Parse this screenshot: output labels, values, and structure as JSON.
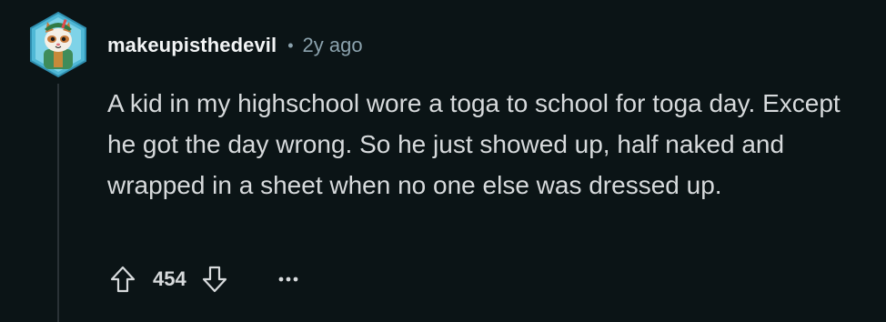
{
  "comment": {
    "username": "makeupisthedevil",
    "separator": "•",
    "timestamp": "2y ago",
    "body": "A kid in my highschool wore a toga to school for toga day. Except he got the day wrong. So he just showed up, half naked and wrapped in a sheet when no one else was dressed up.",
    "score": "454"
  },
  "icons": {
    "avatar": "cat-avatar-icon",
    "upvote": "upvote-arrow-icon",
    "downvote": "downvote-arrow-icon",
    "more": "more-options-icon"
  },
  "colors": {
    "background": "#0b1416",
    "username": "#f2f4f5",
    "meta": "#8ba2ad",
    "text": "#d7dadc",
    "thread_line": "#2a3236"
  }
}
